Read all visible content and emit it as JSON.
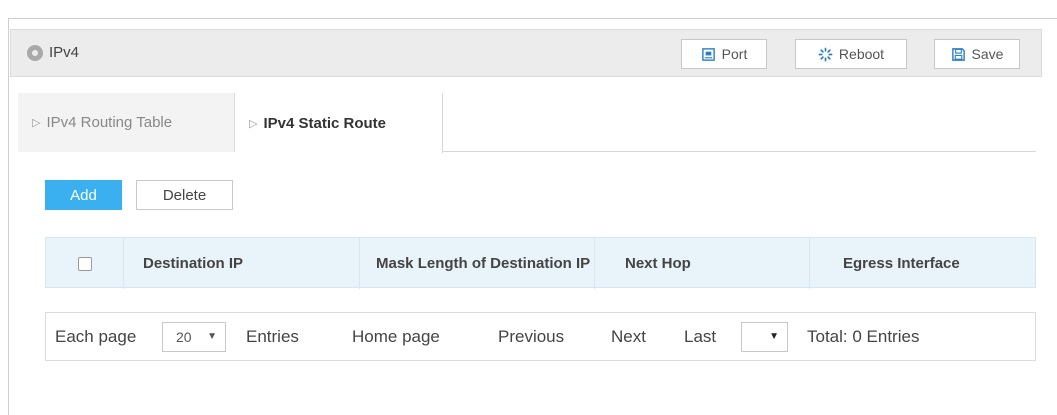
{
  "header": {
    "title": "IPv4",
    "buttons": {
      "port": "Port",
      "reboot": "Reboot",
      "save": "Save"
    }
  },
  "tabs": [
    {
      "label": "IPv4 Routing Table",
      "active": false
    },
    {
      "label": "IPv4 Static Route",
      "active": true
    }
  ],
  "actions": {
    "add": "Add",
    "delete": "Delete"
  },
  "table": {
    "columns": [
      "Destination IP",
      "Mask Length of Destination IP",
      "Next Hop",
      "Egress Interface"
    ],
    "rows": []
  },
  "pager": {
    "each_page": "Each page",
    "page_size": "20",
    "entries": "Entries",
    "home": "Home page",
    "previous": "Previous",
    "next": "Next",
    "last": "Last",
    "jump_value": "",
    "total": "Total: 0 Entries"
  },
  "colors": {
    "accent": "#3ab0f0",
    "header_bg": "#e8f3fa",
    "titlebar_bg": "#ececec"
  }
}
